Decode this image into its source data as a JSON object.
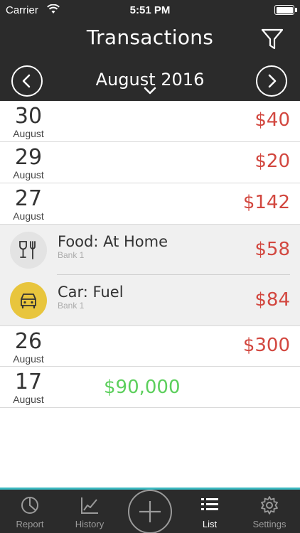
{
  "status_bar": {
    "carrier": "Carrier",
    "time": "5:51 PM"
  },
  "header": {
    "title": "Transactions",
    "month": "August 2016"
  },
  "icons": {
    "filter": "filter-icon",
    "prev": "chevron-left-icon",
    "next": "chevron-right-icon",
    "food": "fork-glass-icon",
    "car": "car-icon"
  },
  "list": {
    "days": [
      {
        "day": "30",
        "month": "August",
        "total": "$40"
      },
      {
        "day": "29",
        "month": "August",
        "total": "$20"
      },
      {
        "day": "27",
        "month": "August",
        "total": "$142"
      },
      {
        "day": "26",
        "month": "August",
        "total": "$300"
      },
      {
        "day": "17",
        "month": "August",
        "income": "$90,000"
      }
    ],
    "transactions": [
      {
        "name": "Food: At Home",
        "account": "Bank 1",
        "amount": "$58"
      },
      {
        "name": "Car: Fuel",
        "account": "Bank 1",
        "amount": "$84"
      }
    ]
  },
  "tabs": [
    {
      "label": "Report"
    },
    {
      "label": "History"
    },
    {
      "label": "List"
    },
    {
      "label": "Settings"
    }
  ],
  "colors": {
    "header_bg": "#2b2b2b",
    "expense": "#d2473f",
    "income": "#5ccf5c",
    "accent": "#3ab8c0",
    "car_icon_bg": "#e8c53d"
  }
}
